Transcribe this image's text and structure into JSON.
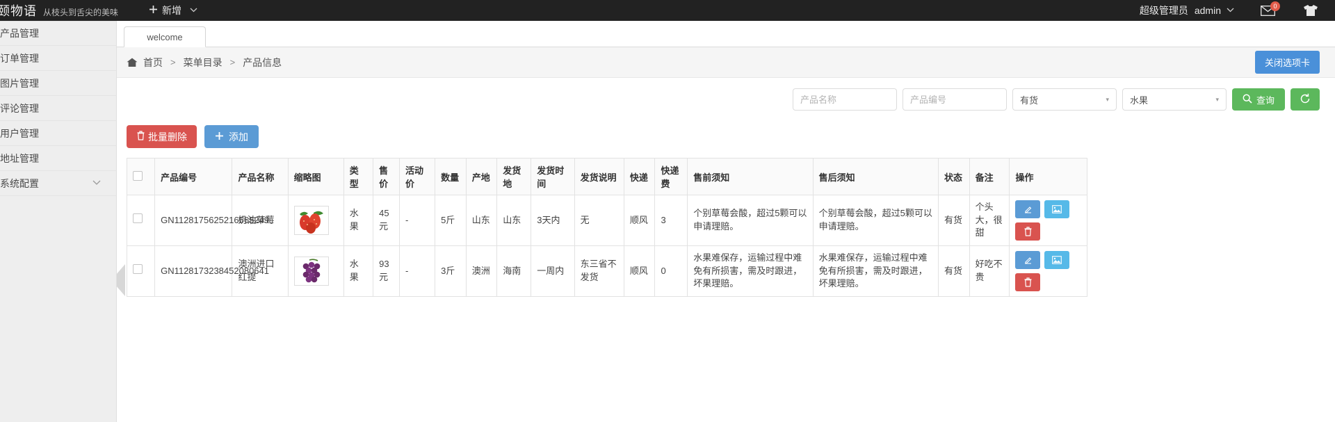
{
  "topbar": {
    "logo_title": "颐物语",
    "logo_sub": "从枝头到舌尖的美味",
    "add_label": "新增",
    "plus": "✛",
    "chevron": "⌄",
    "user_role": "超级管理员",
    "user_name": "admin",
    "mail_badge": "0",
    "mail_icon": "mail-icon",
    "shirt_icon": "shirt-icon"
  },
  "sidebar": {
    "items": [
      {
        "label": "产品管理",
        "expandable": false
      },
      {
        "label": "订单管理",
        "expandable": false
      },
      {
        "label": "图片管理",
        "expandable": false
      },
      {
        "label": "评论管理",
        "expandable": false
      },
      {
        "label": "用户管理",
        "expandable": false
      },
      {
        "label": "地址管理",
        "expandable": false
      },
      {
        "label": "系统配置",
        "expandable": true
      }
    ],
    "chevron_down": "⌄"
  },
  "tabs": {
    "welcome": "welcome"
  },
  "breadcrumb": {
    "home_icon": "home-icon",
    "seg1": "首页",
    "sep": ">",
    "seg2": "菜单目录",
    "seg3": "产品信息",
    "close_tab_label": "关闭选项卡"
  },
  "filters": {
    "name_placeholder": "产品名称",
    "name_value": "",
    "code_placeholder": "产品编号",
    "code_value": "",
    "stock_select": "有货",
    "stock_options": [
      "有货"
    ],
    "type_select": "水果",
    "type_options": [
      "水果"
    ],
    "search_label": "查询",
    "search_icon": "search-icon",
    "refresh_icon": "refresh-icon",
    "caret": "▾"
  },
  "actions": {
    "batch_delete_label": "批量删除",
    "trash_icon": "trash-icon",
    "add_label": "添加",
    "plus_icon": "plus-icon"
  },
  "table": {
    "headers": [
      "",
      "产品编号",
      "产品名称",
      "缩略图",
      "类型",
      "售价",
      "活动价",
      "数量",
      "产地",
      "发货地",
      "发货时间",
      "发货说明",
      "快递",
      "快递费",
      "售前须知",
      "售后须知",
      "状态",
      "备注",
      "操作"
    ],
    "rows": [
      {
        "code": "GN1128175625216565249",
        "name": "奶油草莓",
        "thumb": "strawberry-image",
        "type": "水果",
        "price": "45 元",
        "promo_price": "-",
        "quantity": "5斤",
        "origin": "山东",
        "ship_from": "山东",
        "ship_time": "3天内",
        "ship_note": "无",
        "courier": "顺风",
        "courier_fee": "3",
        "pre_sale": "个别草莓会酸，超过5颗可以申请理赔。",
        "after_sale": "个别草莓会酸，超过5颗可以申请理赔。",
        "status": "有货",
        "remark": "个头大，很甜"
      },
      {
        "code": "GN1128173238452080641",
        "name": "澳洲进口红提",
        "thumb": "grape-image",
        "type": "水果",
        "price": "93 元",
        "promo_price": "-",
        "quantity": "3斤",
        "origin": "澳洲",
        "ship_from": "海南",
        "ship_time": "一周内",
        "ship_note": "东三省不发货",
        "courier": "顺风",
        "courier_fee": "0",
        "pre_sale": "水果难保存，运输过程中难免有所损害，需及时跟进，坏果理赔。",
        "after_sale": "水果难保存，运输过程中难免有所损害，需及时跟进，坏果理赔。",
        "status": "有货",
        "remark": "好吃不贵"
      }
    ],
    "op_buttons": {
      "edit_icon": "edit-icon",
      "image_icon": "image-icon",
      "delete_icon": "trash-icon"
    }
  }
}
